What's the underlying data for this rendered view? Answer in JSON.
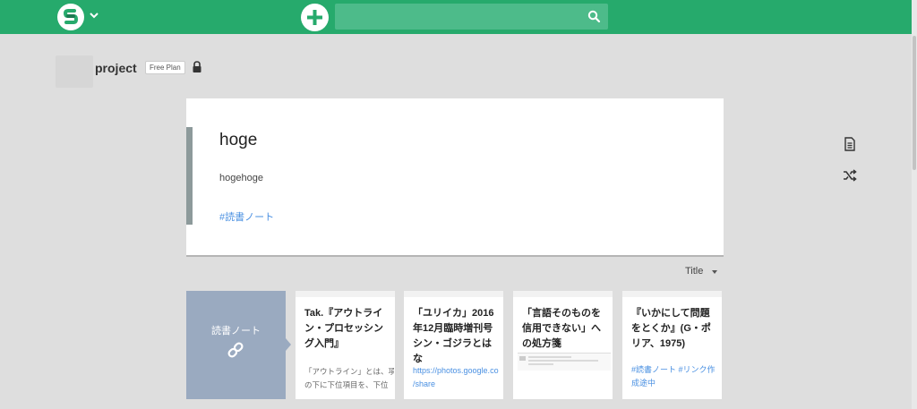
{
  "header": {
    "search_placeholder": ""
  },
  "project": {
    "name": "project",
    "plan": "Free Plan"
  },
  "page": {
    "title": "hoge",
    "line": "hogehoge",
    "tag": "#読書ノート"
  },
  "sort": {
    "label": "Title"
  },
  "tag_card": {
    "title": "読書ノート"
  },
  "cards": [
    {
      "title": "Tak.『アウトライン・プロセッシング入門』",
      "desc_lines": [
        "「アウトライン」とは、項目",
        "の下に下位項目を、下位"
      ]
    },
    {
      "title": "「ユリイカ」2016年12月臨時増刊号 シン・ゴジラとはな",
      "link_lines": [
        "https://photos.google.co",
        "/share"
      ]
    },
    {
      "title": "「言語そのものを信用できない」への処方箋"
    },
    {
      "title": "『いかにして問題をとくか』(G・ポリア、1975)",
      "tags": "#読書ノート #リンク作成途中"
    }
  ],
  "colors": {
    "header": "#26aa6c",
    "background": "#dedede",
    "tag_card": "#9aaac0",
    "link": "#4a90e2"
  }
}
